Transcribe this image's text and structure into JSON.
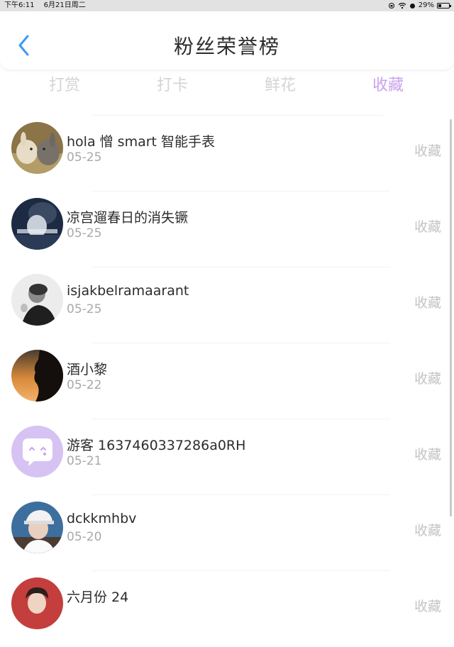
{
  "status_bar": {
    "time": "下午6:11",
    "date": "6月21日周二",
    "battery_percent": "29%",
    "battery_level": 0.29
  },
  "header": {
    "title": "粉丝荣誉榜",
    "back_icon": "chevron-left-icon"
  },
  "tabs": [
    {
      "label": "打赏",
      "active": false
    },
    {
      "label": "打卡",
      "active": false
    },
    {
      "label": "鲜花",
      "active": false
    },
    {
      "label": "收藏",
      "active": true
    }
  ],
  "colors": {
    "accent": "#c9a2ea",
    "back_icon": "#3a9bf4",
    "muted": "#c4c4c4"
  },
  "fans": [
    {
      "name": "hola 憎 smart 智能手表",
      "date": "05-25",
      "action": "收藏",
      "avatar": "photo-rabbits"
    },
    {
      "name": "凉宫遛春日的消失镢",
      "date": "05-25",
      "action": "收藏",
      "avatar": "photo-dark-portrait"
    },
    {
      "name": "isjakbelramaarant",
      "date": "05-25",
      "action": "收藏",
      "avatar": "photo-bw-person"
    },
    {
      "name": "酒小黎",
      "date": "05-22",
      "action": "收藏",
      "avatar": "photo-sunset-silhouette"
    },
    {
      "name": "游客 1637460337286a0RH",
      "date": "05-21",
      "action": "收藏",
      "avatar": "default-chat-icon"
    },
    {
      "name": "dckkmhbv",
      "date": "05-20",
      "action": "收藏",
      "avatar": "photo-person-cap"
    },
    {
      "name": "六月份 24",
      "date": "",
      "action": "收藏",
      "avatar": "photo-person-red"
    }
  ]
}
